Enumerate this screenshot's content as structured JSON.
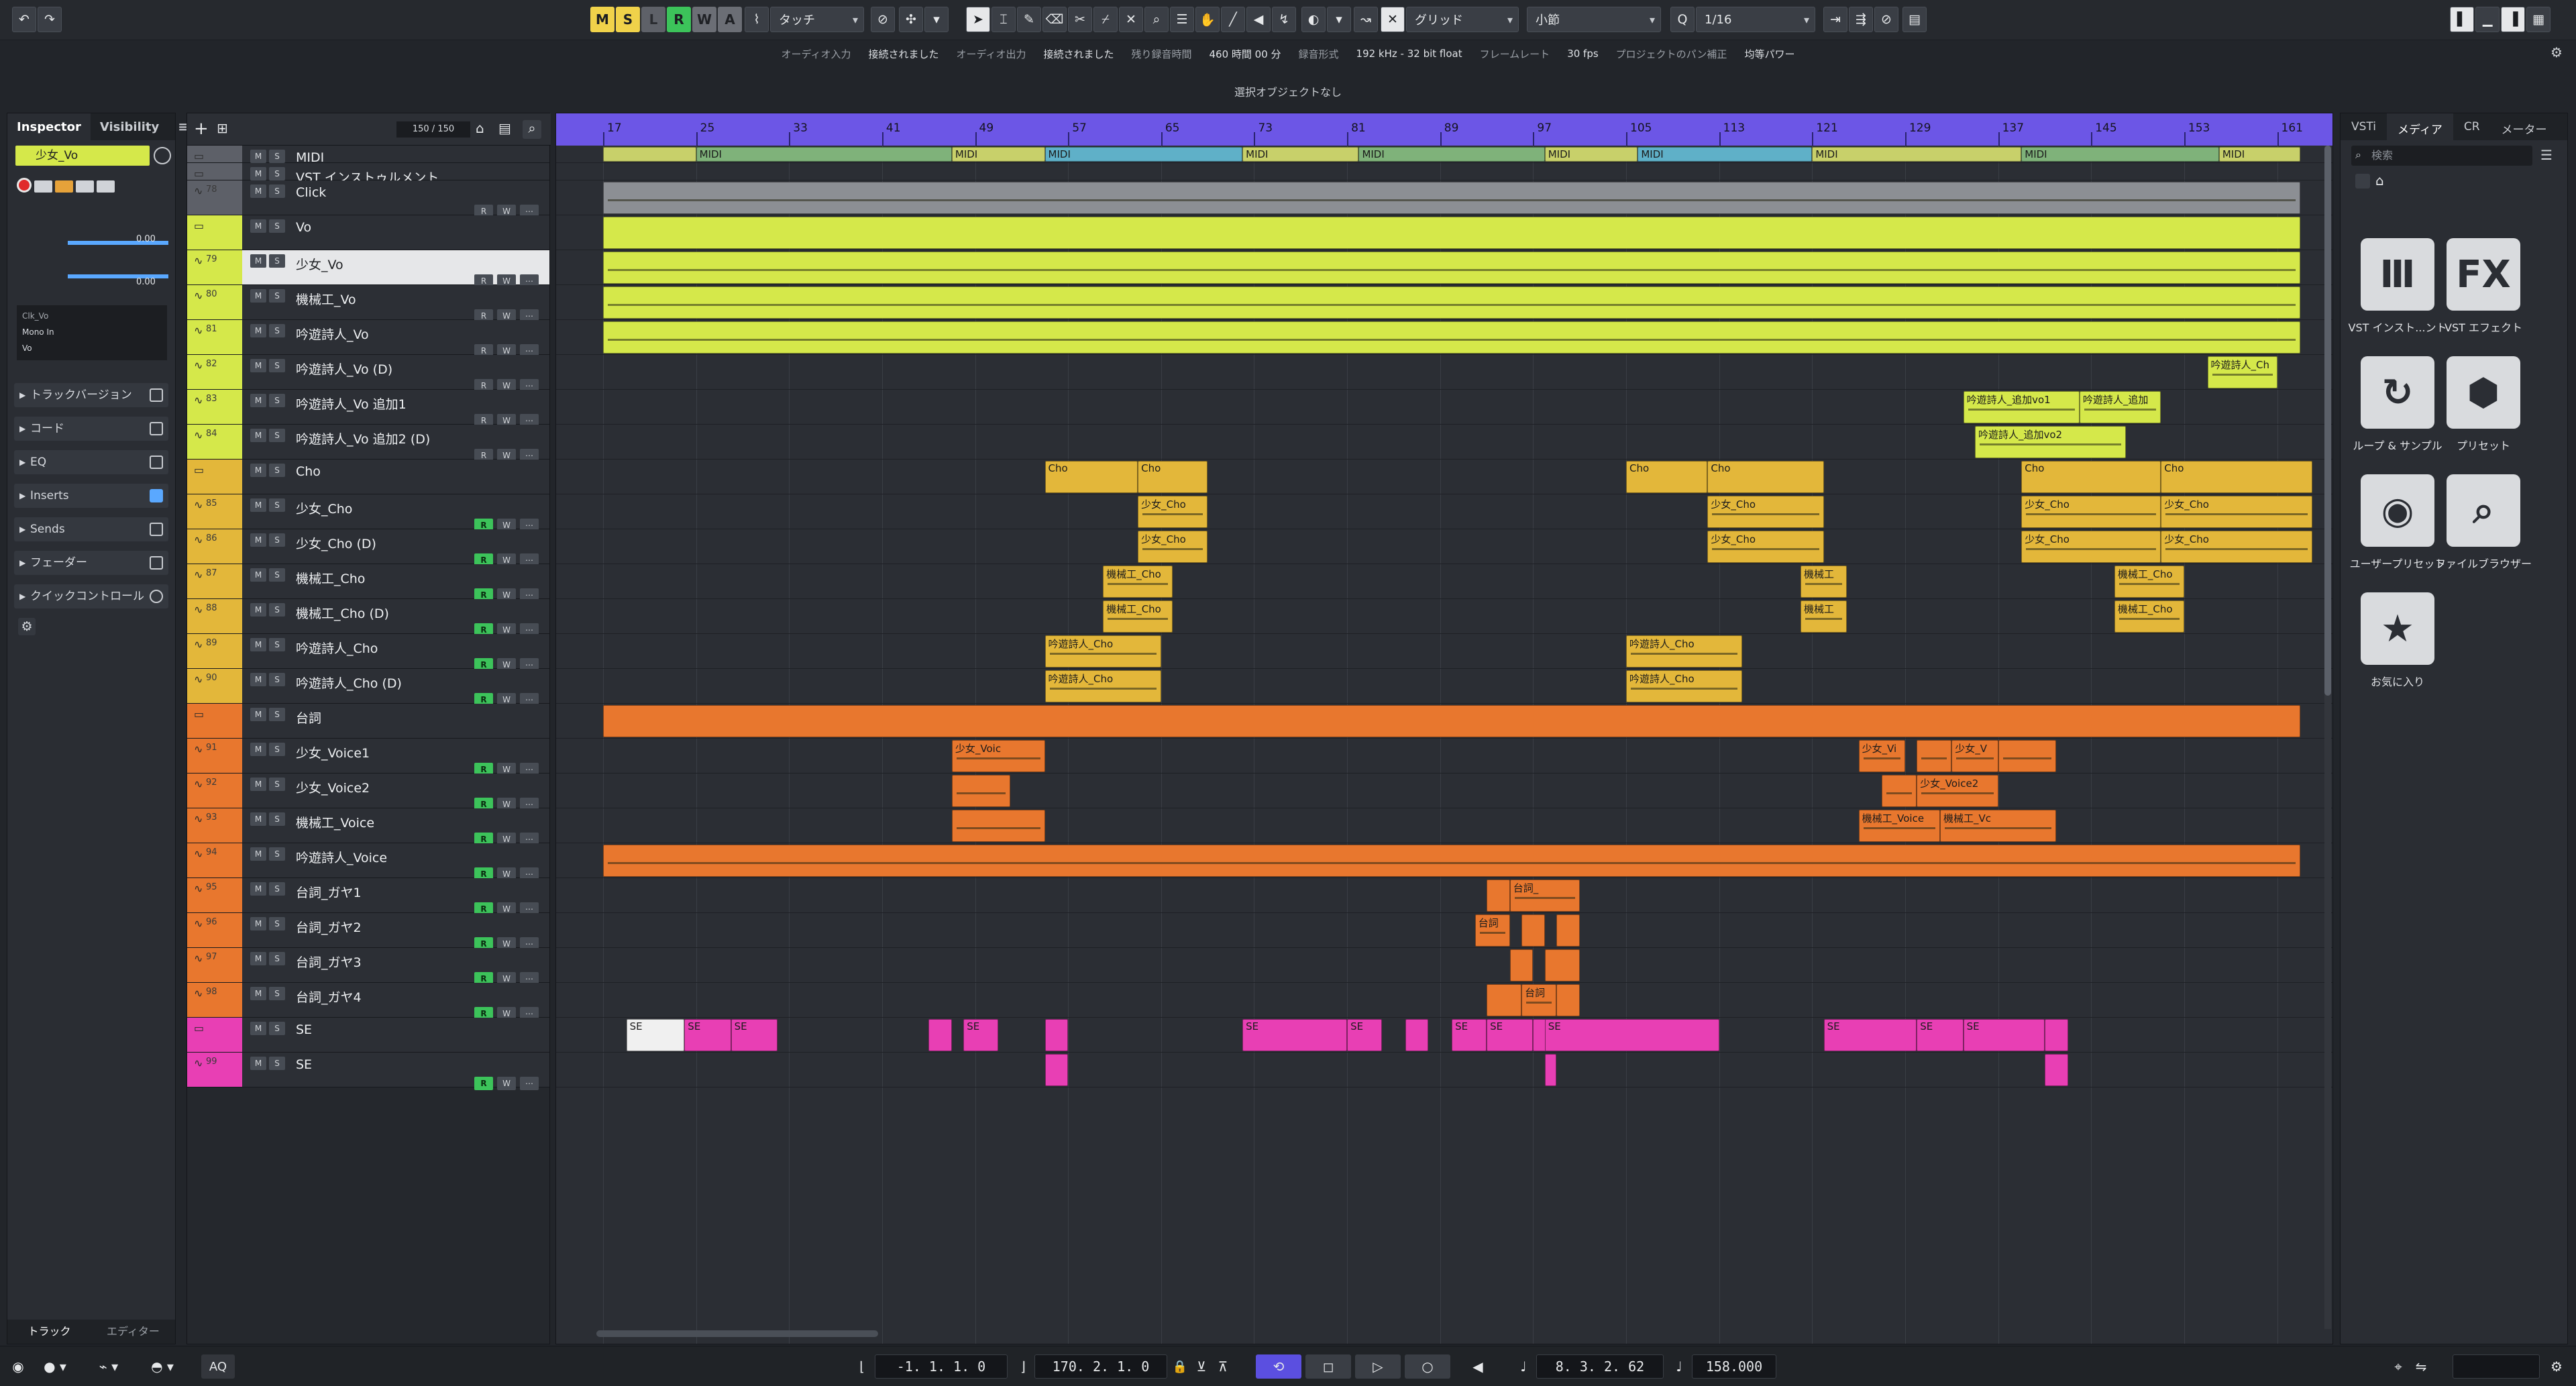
{
  "toolbar": {
    "modes": [
      "M",
      "S",
      "L",
      "R",
      "W",
      "A"
    ],
    "automation_mode": "タッチ",
    "snap_type": "グリッド",
    "grid_unit": "小節",
    "quantize": "1/16"
  },
  "status": {
    "audio_in_label": "オーディオ入力",
    "audio_in_value": "接続されました",
    "audio_out_label": "オーディオ出力",
    "audio_out_value": "接続されました",
    "remaining_label": "残り録音時間",
    "remaining_value": "460 時間 00 分",
    "format_label": "録音形式",
    "format_value": "192 kHz - 32 bit float",
    "frame_label": "フレームレート",
    "frame_value": "30 fps",
    "pan_label": "プロジェクトのパン補正",
    "pan_value": "均等パワー",
    "selection": "選択オブジェクトなし"
  },
  "inspector": {
    "tabs": [
      "Inspector",
      "Visibility"
    ],
    "track_name": "少女_Vo",
    "value1": "0.00",
    "value2": "0.00",
    "routing": [
      "Clk_Vo",
      "Mono In",
      "Vo"
    ],
    "sections": [
      "トラックバージョン",
      "コード",
      "EQ",
      "Inserts",
      "Sends",
      "フェーダー",
      "クイックコントロール"
    ],
    "bottom_tabs": [
      "トラック",
      "エディター"
    ]
  },
  "tracklist": {
    "count": "150 / 150",
    "tracks": [
      {
        "name": "MIDI",
        "num": "",
        "color": "#5d6068"
      },
      {
        "name": "VST インストゥルメント",
        "num": "",
        "color": "#5d6068"
      },
      {
        "name": "Click",
        "num": "78",
        "color": "#5d6068"
      },
      {
        "name": "Vo",
        "num": "",
        "color": "#d5e84a"
      },
      {
        "name": "少女_Vo",
        "num": "79",
        "color": "#d5e84a"
      },
      {
        "name": "機械工_Vo",
        "num": "80",
        "color": "#d5e84a"
      },
      {
        "name": "吟遊詩人_Vo",
        "num": "81",
        "color": "#d5e84a"
      },
      {
        "name": "吟遊詩人_Vo (D)",
        "num": "82",
        "color": "#d5e84a"
      },
      {
        "name": "吟遊詩人_Vo 追加1",
        "num": "83",
        "color": "#d5e84a"
      },
      {
        "name": "吟遊詩人_Vo 追加2 (D)",
        "num": "84",
        "color": "#d5e84a"
      },
      {
        "name": "Cho",
        "num": "",
        "color": "#e3b73a"
      },
      {
        "name": "少女_Cho",
        "num": "85",
        "color": "#e3b73a"
      },
      {
        "name": "少女_Cho (D)",
        "num": "86",
        "color": "#e3b73a"
      },
      {
        "name": "機械工_Cho",
        "num": "87",
        "color": "#e3b73a"
      },
      {
        "name": "機械工_Cho (D)",
        "num": "88",
        "color": "#e3b73a"
      },
      {
        "name": "吟遊詩人_Cho",
        "num": "89",
        "color": "#e3b73a"
      },
      {
        "name": "吟遊詩人_Cho (D)",
        "num": "90",
        "color": "#e3b73a"
      },
      {
        "name": "台詞",
        "num": "",
        "color": "#e8772e"
      },
      {
        "name": "少女_Voice1",
        "num": "91",
        "color": "#e8772e"
      },
      {
        "name": "少女_Voice2",
        "num": "92",
        "color": "#e8772e"
      },
      {
        "name": "機械工_Voice",
        "num": "93",
        "color": "#e8772e"
      },
      {
        "name": "吟遊詩人_Voice",
        "num": "94",
        "color": "#e8772e"
      },
      {
        "name": "台詞_ガヤ1",
        "num": "95",
        "color": "#e8772e"
      },
      {
        "name": "台詞_ガヤ2",
        "num": "96",
        "color": "#e8772e"
      },
      {
        "name": "台詞_ガヤ3",
        "num": "97",
        "color": "#e8772e"
      },
      {
        "name": "台詞_ガヤ4",
        "num": "98",
        "color": "#e8772e"
      },
      {
        "name": "SE",
        "num": "",
        "color": "#e83fb4"
      },
      {
        "name": "SE",
        "num": "99",
        "color": "#e83fb4"
      }
    ]
  },
  "ruler": [
    "17",
    "25",
    "33",
    "41",
    "49",
    "57",
    "65",
    "73",
    "81",
    "89",
    "97",
    "105",
    "113",
    "121",
    "129",
    "137",
    "145",
    "153",
    "161"
  ],
  "events": {
    "midi": "MIDI",
    "cho": "Cho",
    "girl_cho": "少女_Cho",
    "mech_cho": "機械工_Cho",
    "mech_short": "機械工",
    "bard_cho": "吟遊詩人_Cho",
    "bard_add1": "吟遊詩人_追加vo1",
    "bard_add2": "吟遊詩人_追加vo2",
    "bard_add_short": "吟遊詩人_追加",
    "bard_ch": "吟遊詩人_Ch",
    "girl_voice": "少女_Voic",
    "girl_voice_short": "少女_Vi",
    "girl_voice_v": "少女_V",
    "girl_voice2": "少女_Voice2",
    "mech_voice": "機械工_Voice",
    "mech_voice_short": "機械工_Vc",
    "gaya": "台詞_",
    "gaya_short": "台詞",
    "se": "SE"
  },
  "rightzone": {
    "tabs": [
      "VSTi",
      "メディア",
      "CR",
      "メーター"
    ],
    "search_placeholder": "検索",
    "tiles": [
      {
        "icon": "Ⅲ",
        "label": "VST インスト...ント"
      },
      {
        "icon": "FX",
        "label": "VST エフェクト"
      },
      {
        "icon": "↻",
        "label": "ループ & サンプル"
      },
      {
        "icon": "⬢",
        "label": "プリセット"
      },
      {
        "icon": "◉",
        "label": "ユーザープリセット"
      },
      {
        "icon": "⌕",
        "label": "ファイルブラウザー"
      },
      {
        "icon": "★",
        "label": "お気に入り"
      }
    ]
  },
  "transport": {
    "left_locator": "-1. 1. 1.   0",
    "right_locator": "170. 2. 1.   0",
    "position": "8. 3. 2. 62",
    "tempo": "158.000",
    "aq": "AQ"
  },
  "colors": {
    "ruler": "#6c56e6",
    "vo": "#d5e84a",
    "cho": "#e3b73a",
    "voice": "#e8772e",
    "se": "#e83fb4",
    "record_on": "#3cc35a"
  }
}
